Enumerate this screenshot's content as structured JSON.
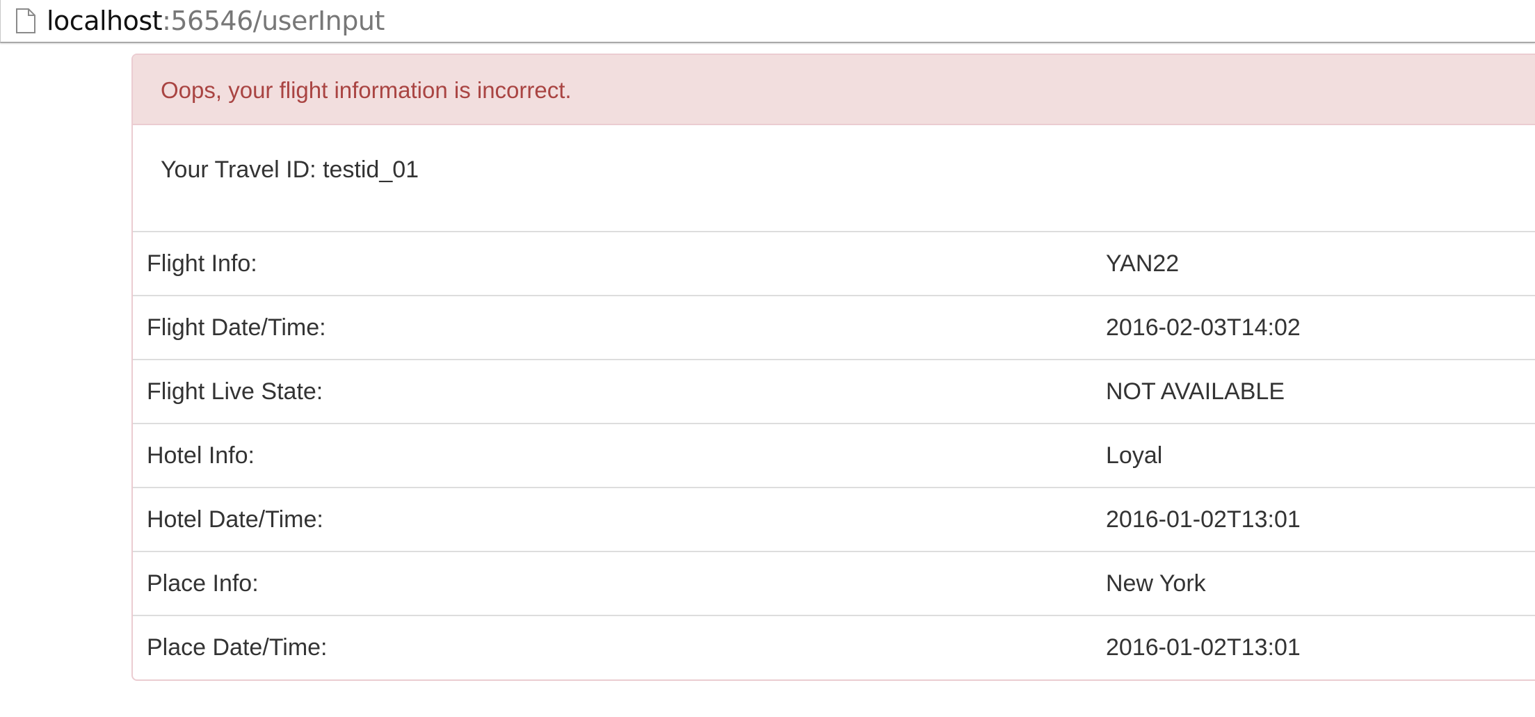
{
  "browser": {
    "url_host": "localhost",
    "url_path": ":56546/userInput",
    "page_icon": "document-icon"
  },
  "alert": {
    "message": "Oops, your flight information is incorrect.",
    "colors": {
      "background": "#f2dede",
      "text": "#a94442",
      "border": "#ebccd1"
    }
  },
  "travel": {
    "id_text": "Your Travel ID: testid_01"
  },
  "rows": [
    {
      "label": "Flight Info:",
      "value": "YAN22"
    },
    {
      "label": "Flight Date/Time:",
      "value": "2016-02-03T14:02"
    },
    {
      "label": "Flight Live State:",
      "value": "NOT AVAILABLE"
    },
    {
      "label": "Hotel Info:",
      "value": "Loyal"
    },
    {
      "label": "Hotel Date/Time:",
      "value": "2016-01-02T13:01"
    },
    {
      "label": "Place Info:",
      "value": "New York"
    },
    {
      "label": "Place Date/Time:",
      "value": "2016-01-02T13:01"
    }
  ]
}
